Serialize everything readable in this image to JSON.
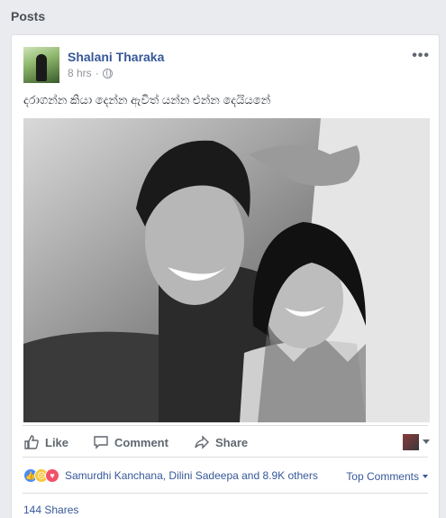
{
  "section": {
    "title": "Posts"
  },
  "post": {
    "author": "Shalani Tharaka",
    "time": "8 hrs",
    "more_label": "•••",
    "caption": "දරාගන්න කියා දෙන්න ඇවිත් යන්න එන්න දෙයියනේ",
    "photo_icon": "couple-selfie-photo"
  },
  "actions": {
    "like_label": "Like",
    "comment_label": "Comment",
    "share_label": "Share"
  },
  "reactions": {
    "icons": [
      "like-icon",
      "sad-icon",
      "love-icon"
    ],
    "names": "Samurdhi Kanchana, Dilini Sadeepa and 8.9K others",
    "sort_label": "Top Comments"
  },
  "shares": {
    "label": "144 Shares"
  },
  "colors": {
    "link": "#365899",
    "muted": "#90949c",
    "action": "#606770"
  }
}
